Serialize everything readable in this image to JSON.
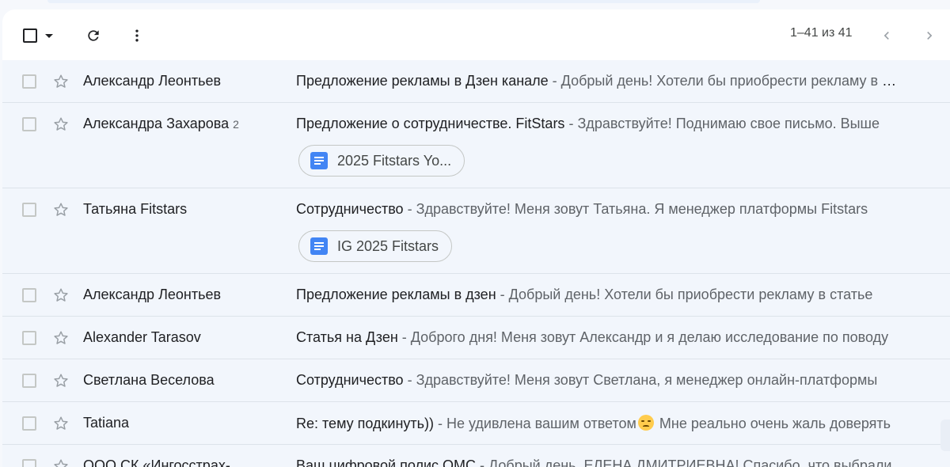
{
  "toolbar": {
    "icons": {
      "select": "checkbox-icon",
      "select_menu": "chevron-down-icon",
      "refresh": "refresh-icon",
      "more": "more-vert-icon",
      "prev": "chevron-left-icon",
      "next": "chevron-right-icon"
    },
    "pagination": "1–41 из 41"
  },
  "emails": [
    {
      "sender": "Александр Леонтьев",
      "count": "",
      "subject": "Предложение рекламы в Дзен канале",
      "separator": " - ",
      "snippet": "Добрый день! Хотели бы приобрести рекламу в статье вашего Дзен канала",
      "attachment": ""
    },
    {
      "sender": "Александра Захарова",
      "count": "2",
      "subject": "Предложение о сотрудничестве. FitStars",
      "separator": " - ",
      "snippet": "Здравствуйте! Поднимаю свое письмо. Выше",
      "attachment": "2025 Fitstars Yo..."
    },
    {
      "sender": "Татьяна Fitstars",
      "count": "",
      "subject": "Сотрудничество",
      "separator": " - ",
      "snippet": "Здравствуйте! Меня зовут Татьяна. Я менеджер платформы Fitstars",
      "attachment": "IG 2025 Fitstars"
    },
    {
      "sender": "Александр Леонтьев",
      "count": "",
      "subject": "Предложение рекламы в дзен",
      "separator": " - ",
      "snippet": "Добрый день! Хотели бы приобрести рекламу в статье",
      "attachment": ""
    },
    {
      "sender": "Alexander Tarasov",
      "count": "",
      "subject": "Статья на Дзен",
      "separator": " - ",
      "snippet": "Доброго дня! Меня зовут Александр и я делаю исследование по поводу",
      "attachment": ""
    },
    {
      "sender": "Светлана Веселова",
      "count": "",
      "subject": "Сотрудничество",
      "separator": " - ",
      "snippet": "Здравствуйте! Меня зовут Светлана, я менеджер онлайн-платформы",
      "attachment": ""
    },
    {
      "sender": "Tatiana",
      "count": "",
      "subject": "Re: тему подкинуть))",
      "separator": " - ",
      "snippet": "Не удивлена вашим ответом",
      "snippet_after_emoji": " Мне реально очень жаль доверять",
      "emoji": "disappointed-face-emoji",
      "attachment": ""
    },
    {
      "sender": "ООО СК «Ингосстрах-",
      "count": "",
      "subject": "Ваш цифровой полис ОМС",
      "separator": " - ",
      "snippet": "Добрый день, ЕЛЕНА ДМИТРИЕВНА! Спасибо, что выбрали",
      "attachment": ""
    }
  ],
  "colors": {
    "row_bg": "#f2f6fc",
    "app_bg": "#f6f8fc",
    "doc_icon": "#4285f4",
    "text_primary": "#202124",
    "text_secondary": "#5f6368"
  }
}
